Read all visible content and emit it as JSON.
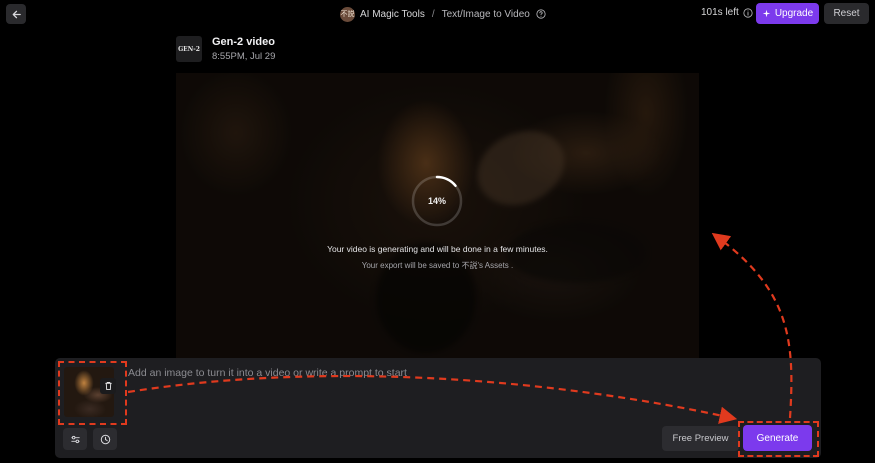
{
  "header": {
    "back_icon": "arrow-left-icon",
    "workspace_avatar": "不説",
    "breadcrumb": [
      "AI Magic Tools",
      "Text/Image to Video"
    ],
    "credits": "101s left",
    "upgrade_label": "Upgrade",
    "reset_label": "Reset"
  },
  "job": {
    "model_logo": "GEN-2",
    "title": "Gen-2 video",
    "time": "8:55PM, Jul 29"
  },
  "render": {
    "progress_text": "14%",
    "progress_fraction": 0.14,
    "status": "Your video is generating and will be done in a few minutes.",
    "export": "Your export will be saved to 不説's Assets ."
  },
  "composer": {
    "placeholder": "Add an image to turn it into a video or write a prompt to start",
    "free_preview_label": "Free Preview",
    "generate_label": "Generate"
  },
  "colors": {
    "accent": "#7c3aed",
    "annotation": "#e03a1e",
    "background": "#000000",
    "panel": "#1e1e21"
  }
}
